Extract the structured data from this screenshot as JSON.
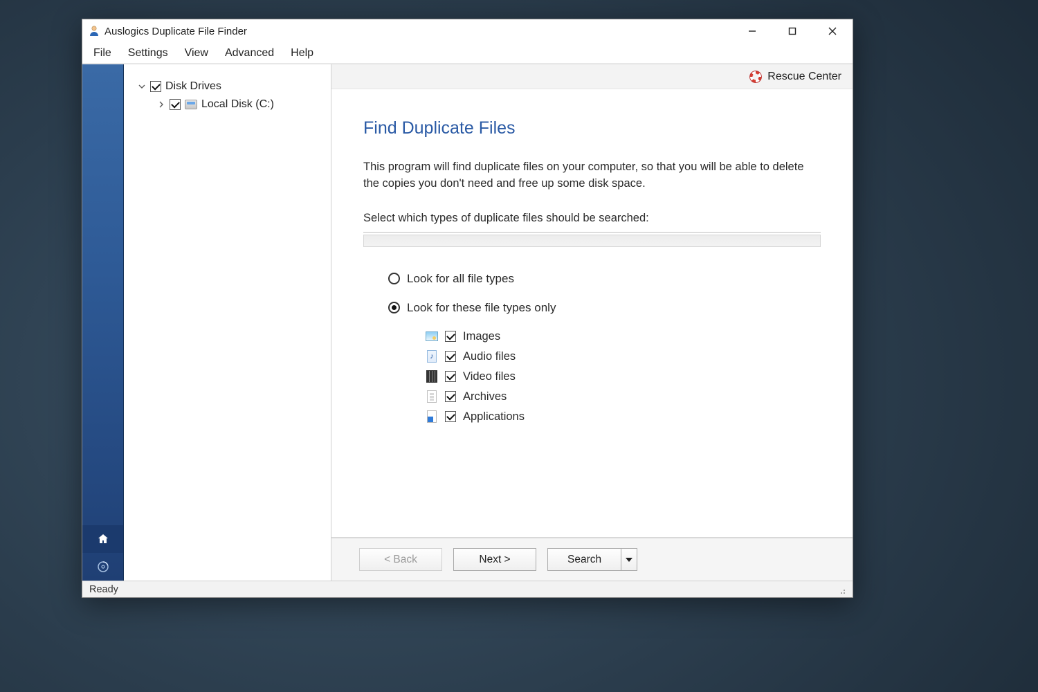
{
  "window": {
    "title": "Auslogics Duplicate File Finder"
  },
  "menu": {
    "items": [
      "File",
      "Settings",
      "View",
      "Advanced",
      "Help"
    ]
  },
  "rescue": {
    "label": "Rescue Center"
  },
  "tree": {
    "root": {
      "label": "Disk Drives",
      "expanded": true,
      "checked": true
    },
    "child": {
      "label": "Local Disk (C:)",
      "expanded": false,
      "checked": true
    }
  },
  "page": {
    "heading": "Find Duplicate Files",
    "intro": "This program will find duplicate files on your computer, so that you will be able to delete the copies you don't need and free up some disk space.",
    "select_prompt": "Select which types of duplicate files should be searched:",
    "radio_all": "Look for all file types",
    "radio_only": "Look for these file types only",
    "types": [
      {
        "id": "images",
        "label": "Images",
        "checked": true
      },
      {
        "id": "audio",
        "label": "Audio files",
        "checked": true
      },
      {
        "id": "video",
        "label": "Video files",
        "checked": true
      },
      {
        "id": "archives",
        "label": "Archives",
        "checked": true
      },
      {
        "id": "applications",
        "label": "Applications",
        "checked": true
      }
    ]
  },
  "footer": {
    "back": "< Back",
    "next": "Next >",
    "search": "Search"
  },
  "status": {
    "text": "Ready"
  }
}
